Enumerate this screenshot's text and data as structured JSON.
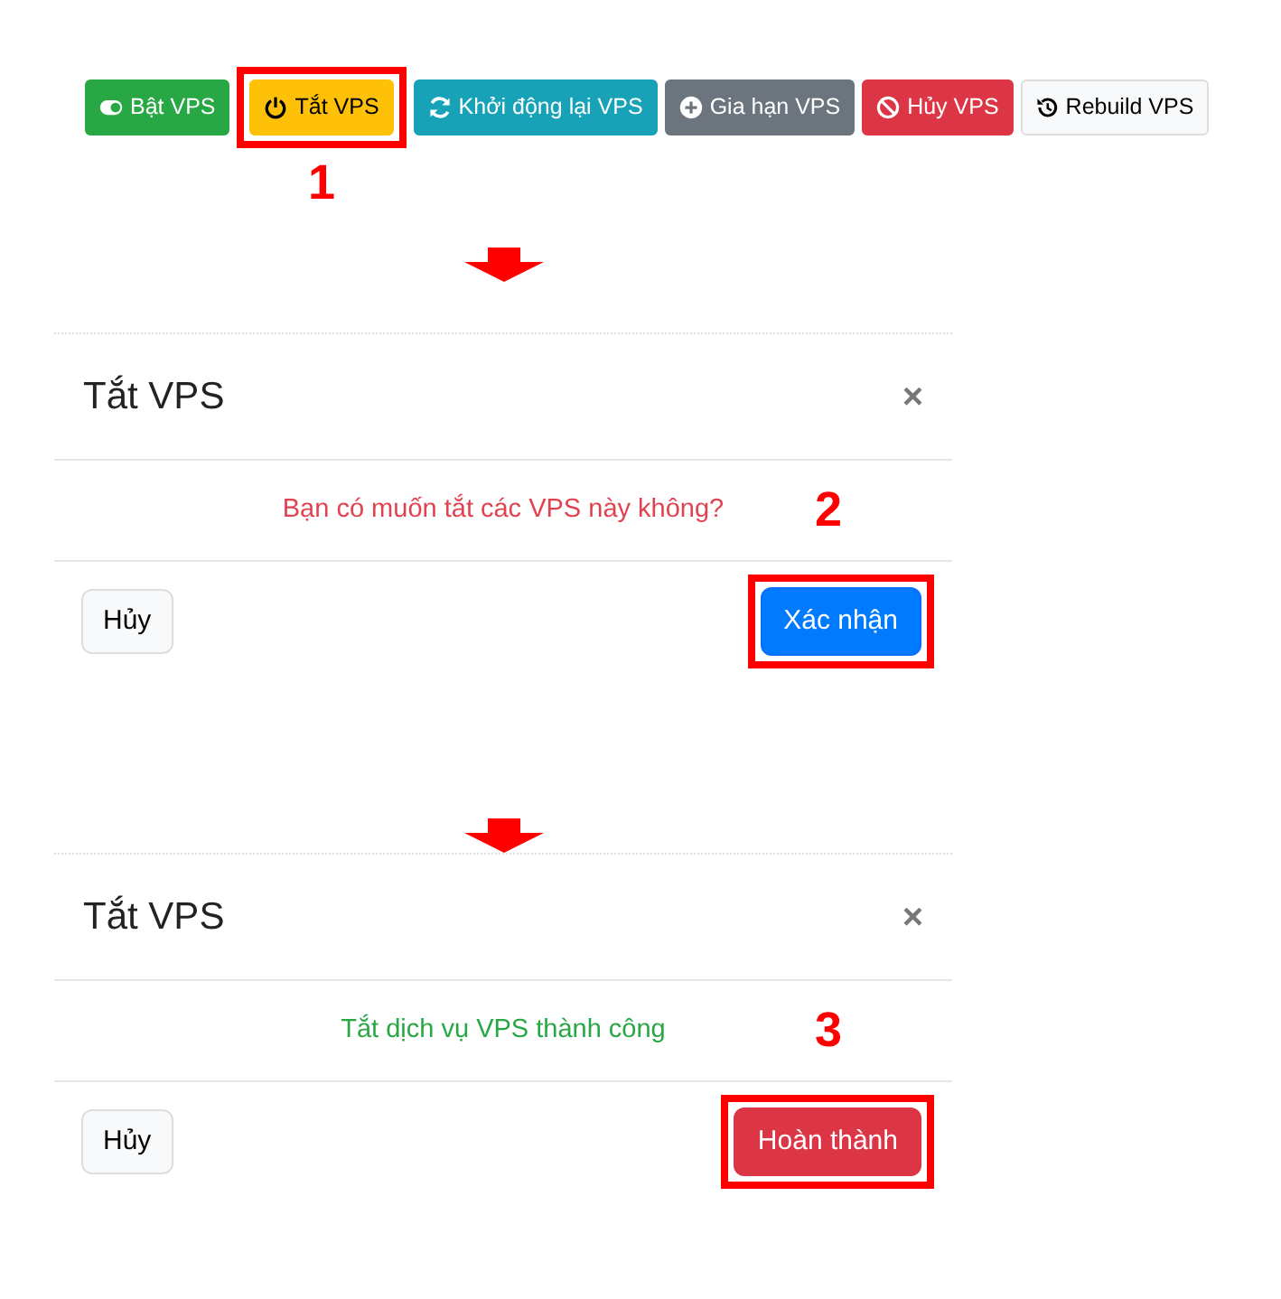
{
  "toolbar": {
    "buttons": [
      {
        "label": "Bật VPS",
        "kind": "success",
        "highlighted": false
      },
      {
        "label": "Tắt VPS",
        "kind": "warning",
        "highlighted": true,
        "step": "1"
      },
      {
        "label": "Khởi động lại VPS",
        "kind": "info",
        "highlighted": false
      },
      {
        "label": "Gia hạn VPS",
        "kind": "secondary",
        "highlighted": false
      },
      {
        "label": "Hủy VPS",
        "kind": "danger",
        "highlighted": false
      },
      {
        "label": "Rebuild VPS",
        "kind": "light",
        "highlighted": false
      }
    ]
  },
  "dialogs": [
    {
      "title": "Tắt VPS",
      "close": "×",
      "message": "Bạn có muốn tắt các VPS này không?",
      "kind": "danger",
      "cancel": "Hủy",
      "action": {
        "label": "Xác nhận",
        "kind": "primary",
        "highlighted": true,
        "step": "2"
      }
    },
    {
      "title": "Tắt VPS",
      "close": "×",
      "message": "Tắt dịch vụ VPS thành công",
      "kind": "success",
      "cancel": "Hủy",
      "action": {
        "label": "Hoàn thành",
        "kind": "danger",
        "highlighted": true,
        "step": "3"
      }
    }
  ]
}
